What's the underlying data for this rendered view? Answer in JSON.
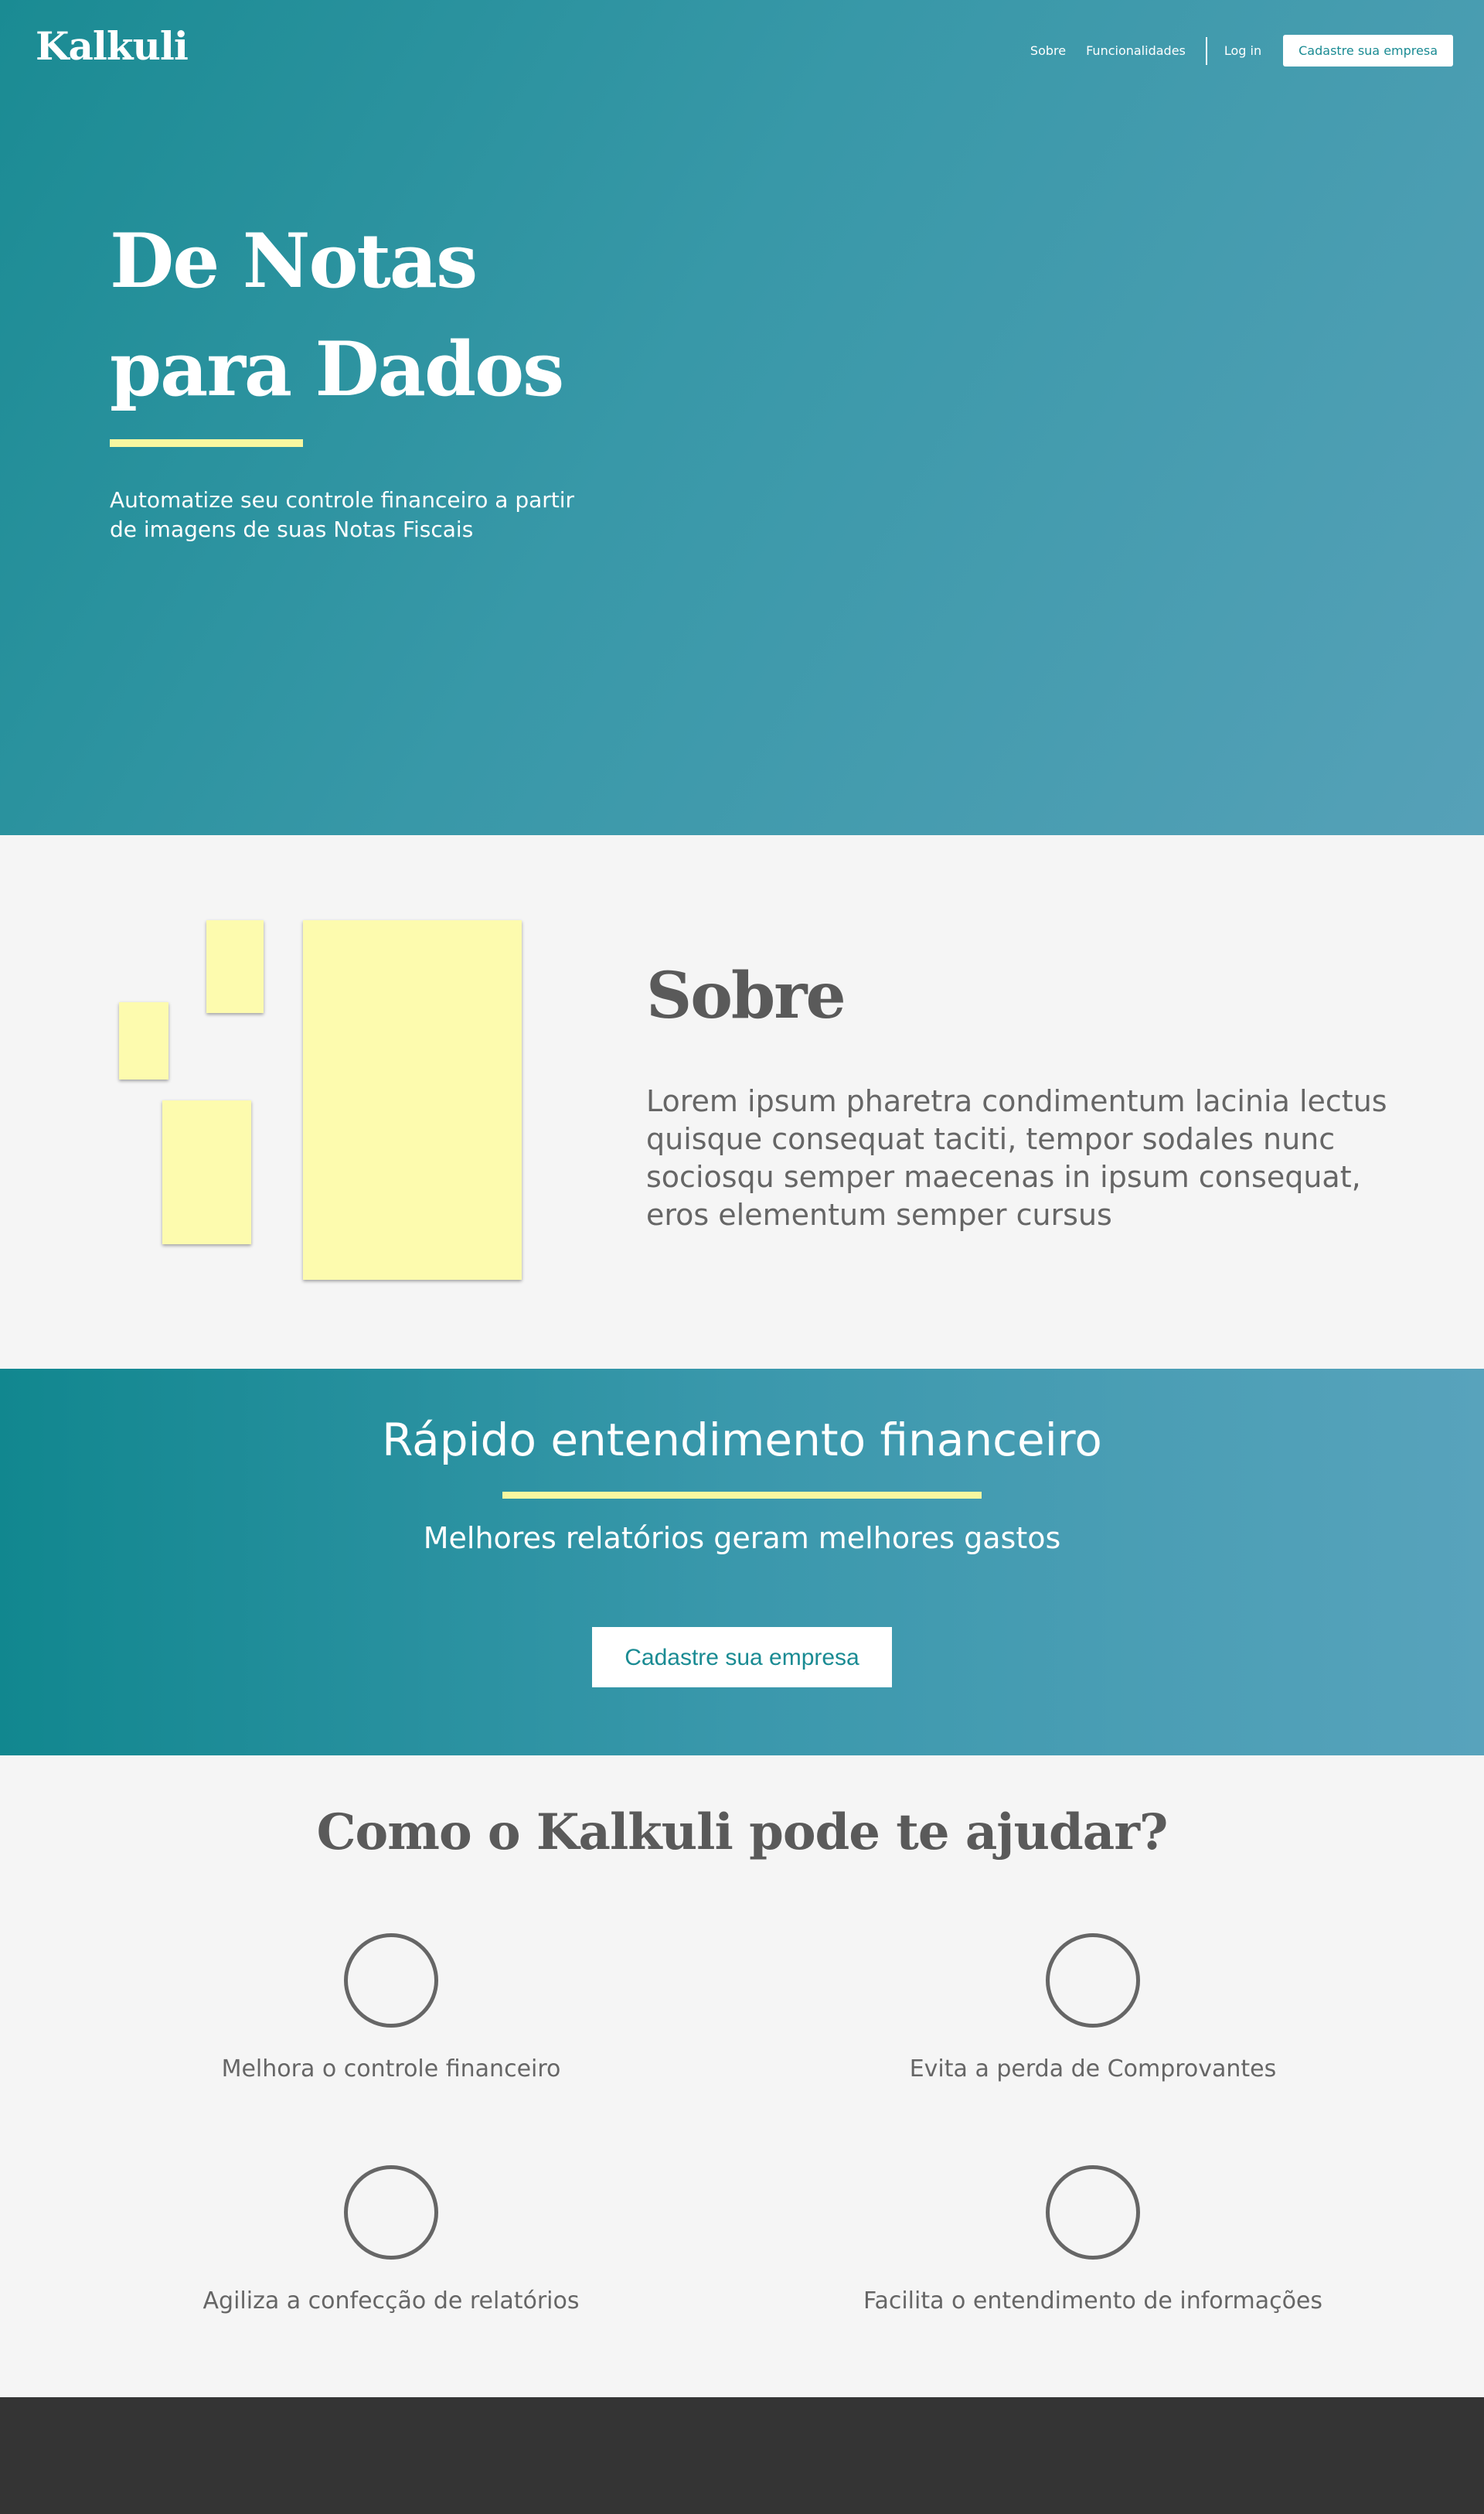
{
  "header": {
    "logo": "Kalkuli",
    "nav": {
      "sobre": "Sobre",
      "funcionalidades": "Funcionalidades",
      "login": "Log in",
      "cta": "Cadastre sua empresa"
    }
  },
  "hero": {
    "title_line1": "De Notas",
    "title_line2": "para Dados",
    "subtitle": "Automatize seu controle financeiro a partir de imagens de suas Notas Fiscais"
  },
  "sobre": {
    "title": "Sobre",
    "text": "Lorem ipsum pharetra condimentum lacinia lectus quisque consequat taciti, tempor sodales nunc sociosqu semper maecenas in ipsum consequat, eros elementum semper cursus"
  },
  "band": {
    "title": "Rápido entendimento financeiro",
    "subtitle": "Melhores relatórios geram melhores gastos",
    "button": "Cadastre sua empresa"
  },
  "features": {
    "title": "Como o Kalkuli pode te ajudar?",
    "items": [
      {
        "label": "Melhora o controle financeiro"
      },
      {
        "label": "Evita a perda de Comprovantes"
      },
      {
        "label": "Agiliza a confecção de relatórios"
      },
      {
        "label": "Facilita o entendimento de informações"
      }
    ]
  },
  "colors": {
    "teal": "#1a8b93",
    "accent_yellow": "#f8f7a0",
    "note_yellow": "#fdfbae",
    "dark_text": "#5a5a5a",
    "footer": "#343434"
  }
}
